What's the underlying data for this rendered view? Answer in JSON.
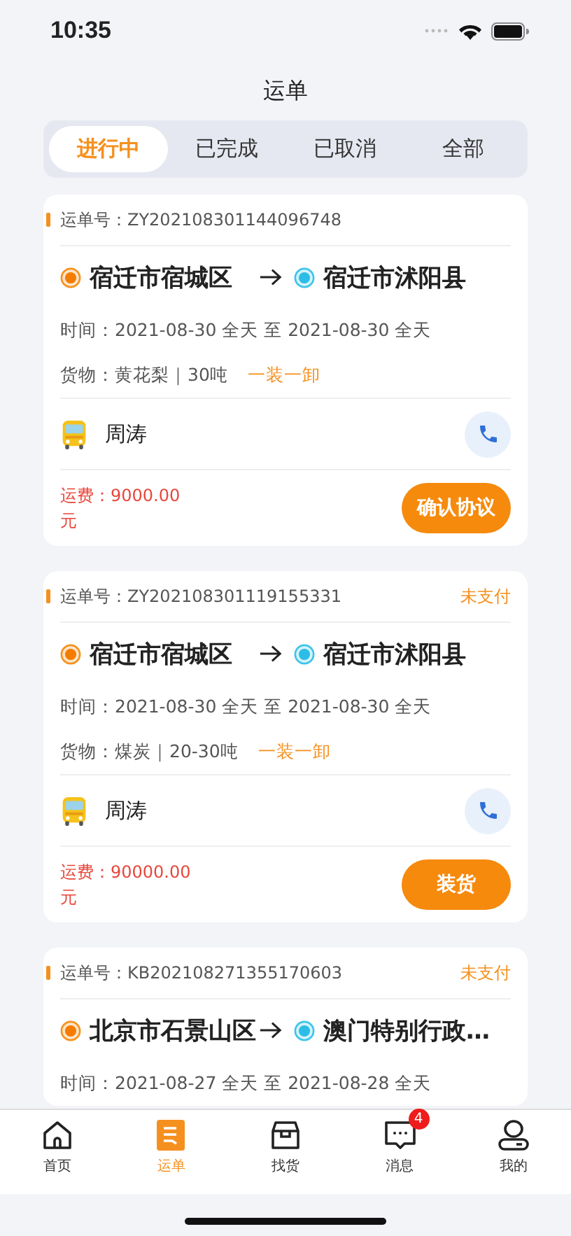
{
  "status_bar": {
    "time": "10:35"
  },
  "title": "运单",
  "tabs": [
    {
      "label": "进行中",
      "selected": true
    },
    {
      "label": "已完成",
      "selected": false
    },
    {
      "label": "已取消",
      "selected": false
    },
    {
      "label": "全部",
      "selected": false
    }
  ],
  "orders": [
    {
      "order_label": "运单号：",
      "order_no": "ZY202108301144096748",
      "from": "宿迁市宿城区",
      "to": "宿迁市沭阳县",
      "time": "时间：2021-08-30 全天 至 2021-08-30 全天",
      "cargo": "货物：黄花梨｜30吨",
      "load_type": "一装一卸",
      "driver": "周涛",
      "fee": "运费：9000.00元",
      "action": "确认协议"
    },
    {
      "order_label": "运单号：",
      "order_no": "ZY202108301119155331",
      "status": "未支付",
      "from": "宿迁市宿城区",
      "to": "宿迁市沭阳县",
      "time": "时间：2021-08-30 全天 至 2021-08-30 全天",
      "cargo": "货物：煤炭｜20-30吨",
      "load_type": "一装一卸",
      "driver": "周涛",
      "fee": "运费：90000.00元",
      "action": "装货"
    },
    {
      "order_label": "运单号：",
      "order_no": "KB202108271355170603",
      "status": "未支付",
      "from": "北京市石景山区",
      "to": "澳门特别行政…",
      "time": "时间：2021-08-27 全天 至 2021-08-28 全天"
    }
  ],
  "bottom_nav": [
    {
      "kind": "home",
      "label": "首页",
      "selected": false
    },
    {
      "kind": "orders",
      "label": "运单",
      "selected": true
    },
    {
      "kind": "goods",
      "label": "找货",
      "selected": false
    },
    {
      "kind": "messages",
      "label": "消息",
      "selected": false,
      "badge": "4"
    },
    {
      "kind": "profile",
      "label": "我的",
      "selected": false
    }
  ]
}
